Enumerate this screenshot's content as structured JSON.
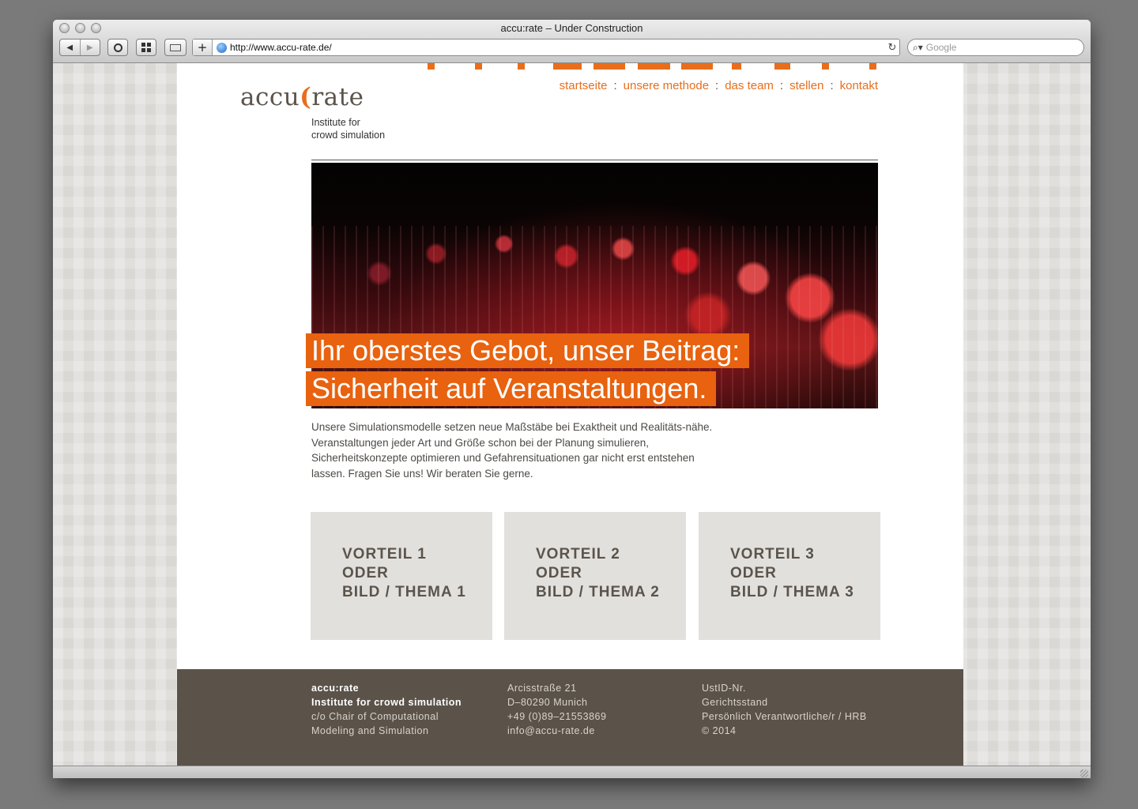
{
  "window": {
    "title": "accu:rate – Under Construction"
  },
  "toolbar": {
    "back_label": "◀",
    "forward_label": "▶",
    "add_label": "+",
    "url": "http://www.accu-rate.de/",
    "reload_label": "↻",
    "search_placeholder": "Google"
  },
  "site": {
    "logo_left": "accu",
    "logo_mark": "(",
    "logo_right": "rate",
    "tagline_line1": "Institute for",
    "tagline_line2": "crowd simulation",
    "nav": [
      {
        "label": "startseite"
      },
      {
        "label": "unsere methode"
      },
      {
        "label": "das team"
      },
      {
        "label": "stellen"
      },
      {
        "label": "kontakt"
      }
    ],
    "nav_separator": ":",
    "headline_line1": "Ihr oberstes Gebot, unser Beitrag:",
    "headline_line2": "Sicherheit auf Veranstaltungen.",
    "intro": "Unsere Simulationsmodelle setzen neue Maßstäbe bei Exaktheit und Realitäts-nähe. Veranstaltungen jeder Art und Größe schon bei der Planung simulieren, Sicherheitskonzepte optimieren und Gefahrensituationen gar nicht erst entstehen lassen. Fragen Sie uns! Wir beraten Sie gerne.",
    "cards": [
      {
        "line1": "VORTEIL 1",
        "line2": "ODER",
        "line3": "BILD / THEMA 1"
      },
      {
        "line1": "VORTEIL 2",
        "line2": "ODER",
        "line3": "BILD / THEMA 2"
      },
      {
        "line1": "VORTEIL 3",
        "line2": "ODER",
        "line3": "BILD / THEMA 3"
      }
    ]
  },
  "footer": {
    "col1": [
      "accu:rate",
      "Institute for crowd simulation",
      "c/o Chair of Computational",
      "Modeling and Simulation"
    ],
    "col2": [
      "Arcisstraße 21",
      "D–80290 Munich",
      "+49 (0)89–21553869",
      "info@accu-rate.de"
    ],
    "col3": [
      "UstID-Nr.",
      "Gerichtsstand",
      "Persönlich Verantwortliche/r / HRB",
      "© 2014"
    ]
  },
  "colors": {
    "accent": "#e86e1c",
    "text_brown": "#5b544c",
    "footer_bg": "#5b534a",
    "card_bg": "#e2e0dc"
  },
  "icons": [
    "back-arrow-icon",
    "forward-arrow-icon",
    "onepassword-icon",
    "top-sites-grid-icon",
    "window-icon",
    "globe-icon",
    "reload-icon",
    "search-magnifier-icon",
    "resize-grip-icon"
  ]
}
